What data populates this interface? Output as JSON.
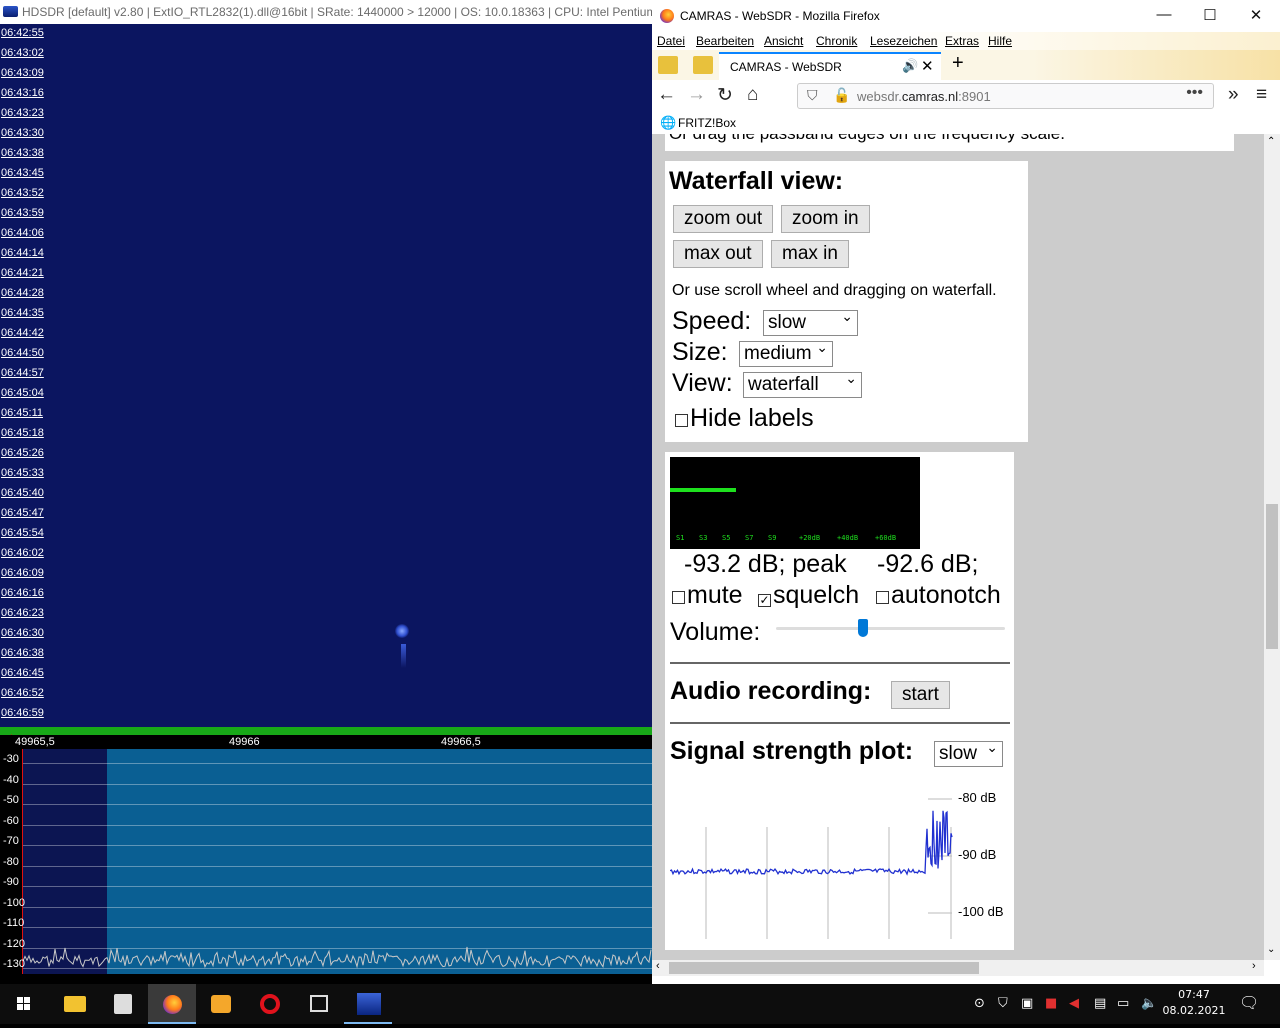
{
  "hdsdr": {
    "title": "HDSDR  [default]  v2.80   | ExtIO_RTL2832(1).dll@16bit  | SRate: 1440000 > 12000  | OS: 10.0.18363  | CPU: Intel Pentium",
    "times": [
      "06:42:55",
      "06:43:02",
      "06:43:09",
      "06:43:16",
      "06:43:23",
      "06:43:30",
      "06:43:38",
      "06:43:45",
      "06:43:52",
      "06:43:59",
      "06:44:06",
      "06:44:14",
      "06:44:21",
      "06:44:28",
      "06:44:35",
      "06:44:42",
      "06:44:50",
      "06:44:57",
      "06:45:04",
      "06:45:11",
      "06:45:18",
      "06:45:26",
      "06:45:33",
      "06:45:40",
      "06:45:47",
      "06:45:54",
      "06:46:02",
      "06:46:09",
      "06:46:16",
      "06:46:23",
      "06:46:30",
      "06:46:38",
      "06:46:45",
      "06:46:52",
      "06:46:59"
    ],
    "freqs": [
      "49965,5",
      "49966",
      "49966,5"
    ],
    "db_labels": [
      "-30",
      "-40",
      "-50",
      "-60",
      "-70",
      "-80",
      "-90",
      "-100",
      "-110",
      "-120",
      "-130"
    ]
  },
  "firefox": {
    "window_title": "CAMRAS - WebSDR - Mozilla Firefox",
    "menu": [
      "Datei",
      "Bearbeiten",
      "Ansicht",
      "Chronik",
      "Lesezeichen",
      "Extras",
      "Hilfe"
    ],
    "tab_title": "CAMRAS - WebSDR",
    "url_prefix": "websdr.",
    "url_domain": "camras.nl",
    "url_suffix": ":8901",
    "bookmark": "FRITZ!Box",
    "page": {
      "top_text": "Or drag the passband edges on the frequency scale.",
      "waterfall_heading": "Waterfall view:",
      "zoom_out": "zoom out",
      "zoom_in": "zoom in",
      "max_out": "max out",
      "max_in": "max in",
      "wf_hint": "Or use scroll wheel and dragging on waterfall.",
      "speed_label": "Speed:",
      "speed_value": "slow",
      "size_label": "Size:",
      "size_value": "medium",
      "view_label": "View:",
      "view_value": "waterfall",
      "hide_labels": "Hide labels",
      "smeter_scale": [
        "S1",
        "S3",
        "S5",
        "S7",
        "S9",
        "+20dB",
        "+40dB",
        "+60dB"
      ],
      "level_text": "-93.2 dB; peak",
      "peak_text": "-92.6 dB;",
      "mute": "mute",
      "squelch": "squelch",
      "autonotch": "autonotch",
      "volume_label": "Volume:",
      "volume_level": 0.38,
      "audio_heading": "Audio recording:",
      "start": "start",
      "signal_heading": "Signal strength plot:",
      "signal_speed": "slow",
      "plot_labels": [
        "-80 dB",
        "-90 dB",
        "-100 dB"
      ]
    }
  },
  "taskbar": {
    "time": "07:47",
    "date": "08.02.2021"
  }
}
